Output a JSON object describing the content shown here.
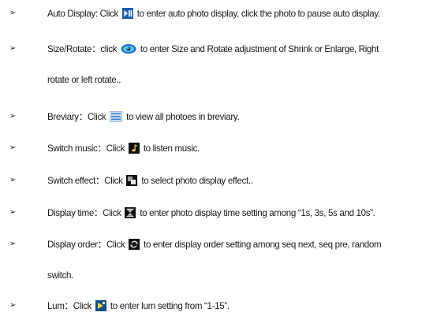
{
  "bullet_glyph": "➢",
  "items": [
    {
      "label": "Auto Display: Click",
      "icon": "play-pause-icon",
      "rest": "to enter auto photo display, click the photo to pause auto display."
    },
    {
      "label": "Size/Rotate：click",
      "icon": "eye-icon",
      "rest": "to enter Size and Rotate adjustment of Shrink or Enlarge, Right",
      "cont": "rotate or left rotate.."
    },
    {
      "label": "Breviary：Click",
      "icon": "list-icon",
      "rest": "to view all photoes in breviary."
    },
    {
      "label": "Switch music：Click",
      "icon": "music-note-icon",
      "rest": " to listen music."
    },
    {
      "label": "Switch effect：Click",
      "icon": "effect-icon",
      "rest": "to select photo display effect.."
    },
    {
      "label": "Display time：Click",
      "icon": "hourglass-icon",
      "rest": "to enter photo display time setting among “1s, 3s, 5s and 10s”."
    },
    {
      "label": "Display order：Click",
      "icon": "order-icon",
      "rest": "to enter display order setting among seq next, seq pre, random",
      "cont": "switch."
    },
    {
      "label": "Lum：Click",
      "icon": "brightness-icon",
      "rest": "to enter lum setting from “1-15”."
    }
  ]
}
